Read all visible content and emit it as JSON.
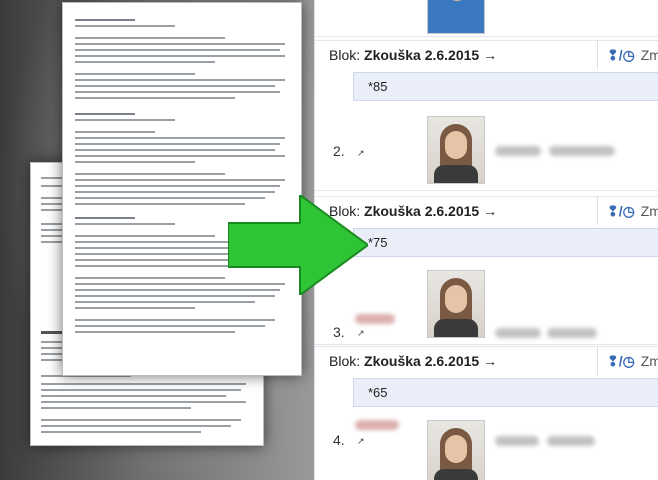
{
  "roster": {
    "entries": [
      {
        "number": "",
        "blok_label": "Blok:",
        "blok_value": "Zkouška 2.6.2015",
        "blok_arrow": "→",
        "tool_text": "Zm",
        "score": "*85"
      },
      {
        "number": "2.",
        "blok_label": "Blok:",
        "blok_value": "Zkouška 2.6.2015",
        "blok_arrow": "→",
        "tool_text": "Změ",
        "score": "*75"
      },
      {
        "number": "3.",
        "blok_label": "Blok:",
        "blok_value": "Zkouška 2.6.2015",
        "blok_arrow": "→",
        "tool_text": "Změ",
        "score": "*65"
      },
      {
        "number": "4."
      }
    ]
  },
  "icons": {
    "external_link": "external-link-icon",
    "edit_tool": "edit-tool-icon",
    "arrow": "arrow-right-icon"
  },
  "colors": {
    "arrow_fill": "#2ec436",
    "arrow_stroke": "#1a8a20",
    "score_bg": "#e9eef8"
  }
}
